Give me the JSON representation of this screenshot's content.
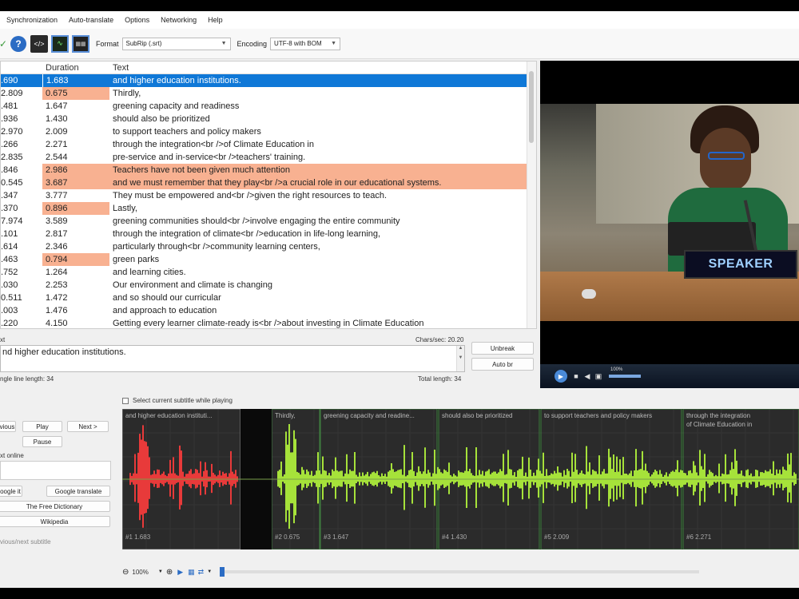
{
  "menu": [
    "Synchronization",
    "Auto-translate",
    "Options",
    "Networking",
    "Help"
  ],
  "toolbar": {
    "format_label": "Format",
    "format_value": "SubRip (.srt)",
    "encoding_label": "Encoding",
    "encoding_value": "UTF-8 with BOM"
  },
  "grid": {
    "col_duration": "Duration",
    "col_text": "Text",
    "rows": [
      {
        "start": ".690",
        "duration": "1.683",
        "text": "and higher education institutions."
      },
      {
        "start": "2.809",
        "duration": "0.675",
        "text": "Thirdly,"
      },
      {
        "start": ".481",
        "duration": "1.647",
        "text": "greening capacity and readiness"
      },
      {
        "start": ".936",
        "duration": "1.430",
        "text": "  should also be prioritized"
      },
      {
        "start": "2.970",
        "duration": "2.009",
        "text": " to support teachers and policy makers"
      },
      {
        "start": ".266",
        "duration": "2.271",
        "text": "through the integration<br />of Climate Education in"
      },
      {
        "start": "2.835",
        "duration": "2.544",
        "text": "pre-service and in-service<br />teachers' training."
      },
      {
        "start": ".846",
        "duration": "2.986",
        "text": "Teachers have not been given much attention"
      },
      {
        "start": "0.545",
        "duration": "3.687",
        "text": "and we must remember that they play<br />a crucial role in our educational systems."
      },
      {
        "start": ".347",
        "duration": "3.777",
        "text": "They must be empowered and<br />given the right resources to teach."
      },
      {
        "start": ".370",
        "duration": "0.896",
        "text": "Lastly,"
      },
      {
        "start": "7.974",
        "duration": "3.589",
        "text": "greening communities should<br />involve engaging the entire community"
      },
      {
        "start": ".101",
        "duration": "2.817",
        "text": "through the integration of climate<br />education in life-long learning,"
      },
      {
        "start": ".614",
        "duration": "2.346",
        "text": "particularly through<br />community learning centers,"
      },
      {
        "start": ".463",
        "duration": "0.794",
        "text": "green parks"
      },
      {
        "start": ".752",
        "duration": "1.264",
        "text": "and learning cities."
      },
      {
        "start": ".030",
        "duration": "2.253",
        "text": "Our environment and climate is changing"
      },
      {
        "start": "0.511",
        "duration": "1.472",
        "text": "and so should our curricular"
      },
      {
        "start": ".003",
        "duration": "1.476",
        "text": "and approach to education"
      },
      {
        "start": ".220",
        "duration": "4.150",
        "text": "Getting every learner climate-ready is<br />about investing in Climate Education"
      }
    ]
  },
  "video": {
    "sign_text": "SPEAKER",
    "volume_label": "100%"
  },
  "edit": {
    "label": "xt",
    "chars_per_sec": "Chars/sec: 20.20",
    "value": "nd higher education institutions.",
    "single_line_length": "ngle line length: 34",
    "total_length": "Total length: 34",
    "unbreak": "Unbreak",
    "auto_br": "Auto br"
  },
  "bottom": {
    "select_current": "Select current subtitle while playing",
    "previous": "vious",
    "play": "Play",
    "next": "Next >",
    "pause": "Pause",
    "text_online": "xt online",
    "google_it": "oogle it",
    "google_translate": "Google translate",
    "free_dictionary": "The Free Dictionary",
    "wikipedia": "Wikipedia",
    "prev_next": "vious/next subtitle",
    "zoom": "100%"
  },
  "waveform": {
    "segments": [
      {
        "label": "and higher education instituti...",
        "num": "#1  1.683"
      },
      {
        "label": "Thirdly,",
        "num": "#2  0.675"
      },
      {
        "label": "greening capacity and readine...",
        "num": "#3  1.647"
      },
      {
        "label": "should also be prioritized",
        "num": "#4  1.430"
      },
      {
        "label": "to support teachers and policy makers",
        "num": "#5  2.009"
      },
      {
        "label": "through the integration",
        "label2": "of Climate Education in",
        "num": "#6  2.271"
      }
    ],
    "selected_color": "#e83a3a",
    "wave_color": "#a6e23a"
  }
}
